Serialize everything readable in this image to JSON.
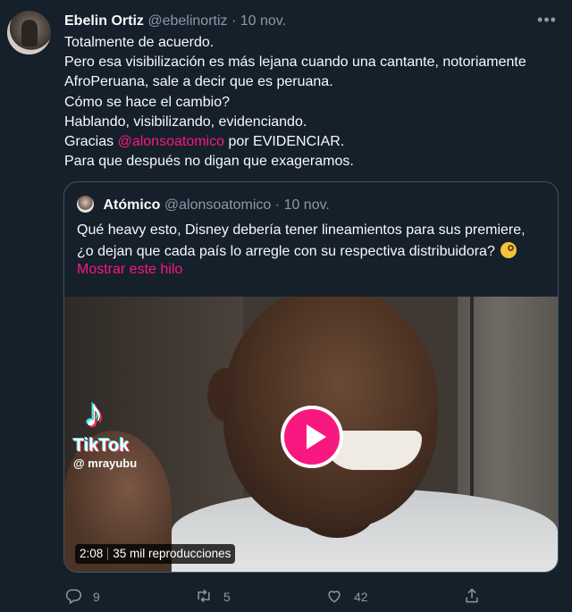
{
  "author": {
    "name": "Ebelin Ortiz",
    "handle": "@ebelinortiz",
    "separator": "·",
    "date": "10 nov."
  },
  "more_icon": "more-options-icon",
  "body": {
    "line1": "Totalmente de acuerdo.",
    "line2": "Pero esa visibilización es más lejana cuando una cantante, notoriamente",
    "line3": "AfroPeruana, sale a decir que es peruana.",
    "line4": "Cómo se hace el cambio?",
    "line5": "Hablando, visibilizando, evidenciando.",
    "line6_pre": "Gracias ",
    "line6_mention": "@alonsoatomico",
    "line6_post": " por EVIDENCIAR.",
    "line7": "Para que después no digan que exageramos."
  },
  "quote": {
    "name": "Atómico",
    "handle": "@alonsoatomico",
    "separator": "·",
    "date": "10 nov.",
    "line1": "Qué heavy esto, Disney debería tener lineamientos para sus premiere,",
    "line2": "¿o dejan que cada país lo arregle con su respectiva distribuidora?",
    "emoji": "face-with-monocle-icon",
    "show_thread": "Mostrar este hilo",
    "video": {
      "watermark_logo": "TikTok",
      "watermark_user": "@ mrayubu",
      "duration": "2:08",
      "views": "35 mil reproducciones"
    }
  },
  "actions": {
    "reply_count": "9",
    "retweet_count": "5",
    "like_count": "42",
    "share_icon": "share-icon"
  },
  "colors": {
    "background": "#15202b",
    "accent": "#f91880",
    "muted": "#8b98a5",
    "border": "#425364"
  }
}
